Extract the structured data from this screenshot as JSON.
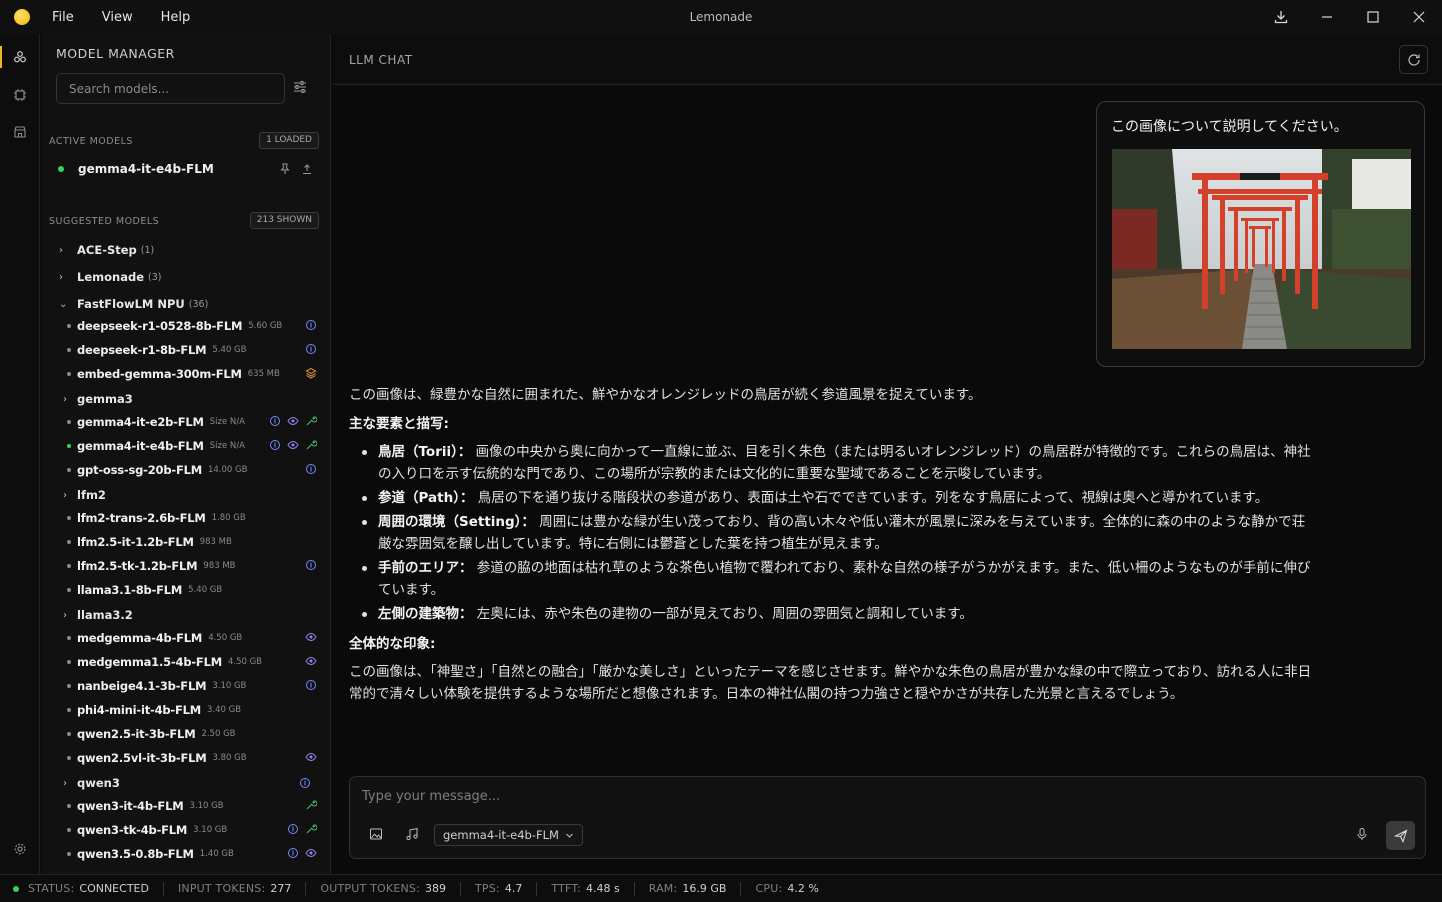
{
  "window": {
    "title": "Lemonade",
    "menu": [
      "File",
      "View",
      "Help"
    ]
  },
  "sidebar": {
    "title": "MODEL MANAGER",
    "search_placeholder": "Search models...",
    "active_label": "ACTIVE MODELS",
    "active_badge": "1 LOADED",
    "active_model": "gemma4-it-e4b-FLM",
    "suggested_label": "SUGGESTED MODELS",
    "suggested_badge": "213 SHOWN",
    "groups": [
      {
        "name": "ACE-Step",
        "count": "(1)"
      },
      {
        "name": "Lemonade",
        "count": "(3)"
      },
      {
        "name": "FastFlowLM NPU",
        "count": "(36)"
      }
    ],
    "models": [
      {
        "name": "deepseek-r1-0528-8b-FLM",
        "size": "5.60 GB"
      },
      {
        "name": "deepseek-r1-8b-FLM",
        "size": "5.40 GB"
      },
      {
        "name": "embed-gemma-300m-FLM",
        "size": "635 MB"
      },
      {
        "name": "gemma3",
        "size": ""
      },
      {
        "name": "gemma4-it-e2b-FLM",
        "size": "Size N/A"
      },
      {
        "name": "gemma4-it-e4b-FLM",
        "size": "Size N/A"
      },
      {
        "name": "gpt-oss-sg-20b-FLM",
        "size": "14.00 GB"
      },
      {
        "name": "lfm2",
        "size": ""
      },
      {
        "name": "lfm2-trans-2.6b-FLM",
        "size": "1.80 GB"
      },
      {
        "name": "lfm2.5-it-1.2b-FLM",
        "size": "983 MB"
      },
      {
        "name": "lfm2.5-tk-1.2b-FLM",
        "size": "983 MB"
      },
      {
        "name": "llama3.1-8b-FLM",
        "size": "5.40 GB"
      },
      {
        "name": "llama3.2",
        "size": ""
      },
      {
        "name": "medgemma-4b-FLM",
        "size": "4.50 GB"
      },
      {
        "name": "medgemma1.5-4b-FLM",
        "size": "4.50 GB"
      },
      {
        "name": "nanbeige4.1-3b-FLM",
        "size": "3.10 GB"
      },
      {
        "name": "phi4-mini-it-4b-FLM",
        "size": "3.40 GB"
      },
      {
        "name": "qwen2.5-it-3b-FLM",
        "size": "2.50 GB"
      },
      {
        "name": "qwen2.5vl-it-3b-FLM",
        "size": "3.80 GB"
      },
      {
        "name": "qwen3",
        "size": ""
      },
      {
        "name": "qwen3-it-4b-FLM",
        "size": "3.10 GB"
      },
      {
        "name": "qwen3-tk-4b-FLM",
        "size": "3.10 GB"
      },
      {
        "name": "qwen3.5-0.8b-FLM",
        "size": "1.40 GB"
      }
    ]
  },
  "chat": {
    "title": "LLM CHAT",
    "user_message": "この画像について説明してください。",
    "answer_intro": "この画像は、緑豊かな自然に囲まれた、鮮やかなオレンジレッドの鳥居が続く参道風景を捉えています。",
    "heading1": "主な要素と描写:",
    "bullets": [
      {
        "label": "鳥居（Torii）：",
        "text": "画像の中央から奥に向かって一直線に並ぶ、目を引く朱色（または明るいオレンジレッド）の鳥居群が特徴的です。これらの鳥居は、神社の入り口を示す伝統的な門であり、この場所が宗教的または文化的に重要な聖域であることを示唆しています。"
      },
      {
        "label": "参道（Path）：",
        "text": "鳥居の下を通り抜ける階段状の参道があり、表面は土や石でできています。列をなす鳥居によって、視線は奥へと導かれています。"
      },
      {
        "label": "周囲の環境（Setting）：",
        "text": "周囲には豊かな緑が生い茂っており、背の高い木々や低い灌木が風景に深みを与えています。全体的に森の中のような静かで荘厳な雰囲気を醸し出しています。特に右側には鬱蒼とした葉を持つ植生が見えます。"
      },
      {
        "label": "手前のエリア：",
        "text": "参道の脇の地面は枯れ草のような茶色い植物で覆われており、素朴な自然の様子がうかがえます。また、低い柵のようなものが手前に伸びています。"
      },
      {
        "label": "左側の建築物：",
        "text": "左奥には、赤や朱色の建物の一部が見えており、周囲の雰囲気と調和しています。"
      }
    ],
    "heading2": "全体的な印象:",
    "conclusion": "この画像は、「神聖さ」「自然との融合」「厳かな美しさ」といったテーマを感じさせます。鮮やかな朱色の鳥居が豊かな緑の中で際立っており、訪れる人に非日常的で清々しい体験を提供するような場所だと想像されます。日本の神社仏閣の持つ力強さと穏やかさが共存した光景と言えるでしょう。",
    "input_placeholder": "Type your message...",
    "selected_model": "gemma4-it-e4b-FLM"
  },
  "status": {
    "status_label": "STATUS:",
    "status_value": "CONNECTED",
    "input_label": "INPUT TOKENS:",
    "input_value": "277",
    "output_label": "OUTPUT TOKENS:",
    "output_value": "389",
    "tps_label": "TPS:",
    "tps_value": "4.7",
    "ttft_label": "TTFT:",
    "ttft_value": "4.48 s",
    "ram_label": "RAM:",
    "ram_value": "16.9 GB",
    "cpu_label": "CPU:",
    "cpu_value": "4.2 %"
  },
  "colors": {
    "accent": "#f0b429",
    "connected": "#3ccf5a",
    "badge_blue": "#6f8cff",
    "badge_purple": "#9b7cf0",
    "badge_green": "#46c46a",
    "badge_orange": "#e69a3a",
    "torii": "#d4412b"
  }
}
